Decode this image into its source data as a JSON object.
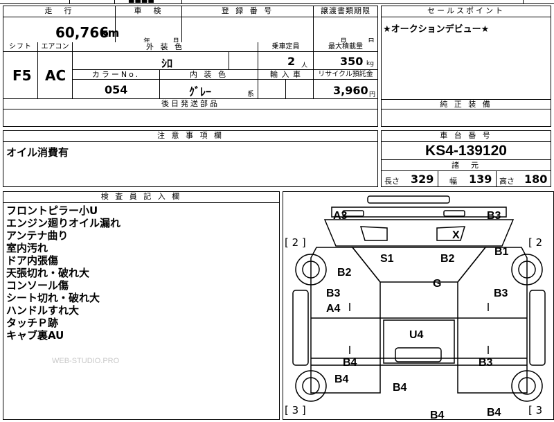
{
  "top_fragment": {
    "text": "■■■■"
  },
  "mileage": {
    "header": "走　行",
    "value": "60,766",
    "unit": "km"
  },
  "inspection": {
    "header": "車　検",
    "year_label": "年",
    "month_label": "月"
  },
  "registration": {
    "header": "登 録 番 号"
  },
  "transfer": {
    "header": "譲渡書類期限",
    "month_label": "月",
    "day_label": "日"
  },
  "sales_point": {
    "header": "セールスポイント",
    "text": "★オークションデビュー★"
  },
  "shift": {
    "header": "シフト",
    "value": "F5"
  },
  "aircon": {
    "header": "エアコン",
    "value": "AC"
  },
  "exterior": {
    "header": "外 装 色",
    "value": "ｼﾛ"
  },
  "capacity": {
    "header": "乗車定員",
    "value": "2",
    "unit": "人"
  },
  "max_load": {
    "header": "最大積載量",
    "value": "350",
    "unit": "kg"
  },
  "color_no": {
    "header": "カラーNo.",
    "value": "054"
  },
  "interior": {
    "header": "内 装 色",
    "value": "ｸﾞﾚｰ",
    "suffix": "系"
  },
  "import": {
    "header": "輸 入 車"
  },
  "recycle": {
    "header": "リサイクル預託金",
    "value": "3,960",
    "unit": "円"
  },
  "later_parts": {
    "header": "後日発送部品"
  },
  "genuine_equip": {
    "header": "純 正 装 備"
  },
  "notes": {
    "header": "注 意 事 項 欄",
    "text": "オイル消費有"
  },
  "chassis": {
    "header": "車 台 番 号",
    "value": "KS4-139120"
  },
  "specs": {
    "header": "諸　元",
    "length_label": "長さ",
    "length": "329",
    "width_label": "幅",
    "width": "139",
    "height_label": "高さ",
    "height": "180"
  },
  "inspector": {
    "header": "検 査 員 記 入 欄",
    "lines": [
      "フロントピラー小U",
      "エンジン廻りオイル漏れ",
      "アンテナ曲り",
      "室内汚れ",
      "ドア内張傷",
      "天張切れ・破れ大",
      "コンソール傷",
      "シート切れ・破れ大",
      "ハンドルすれ大",
      "タッチＰ跡",
      "キャブ裏AU"
    ]
  },
  "watermark": "WEB-STUDIO.PRO",
  "diagram": {
    "bracket_2_left": "[ 2 ]",
    "bracket_2_right": "[ 2",
    "bracket_3_left": "[ 3 ]",
    "bracket_3_right": "[ 3",
    "labels": {
      "A3": "A3",
      "B3_top": "B3",
      "X": "X",
      "B1": "B1",
      "S1": "S1",
      "B2_center": "B2",
      "B2_left": "B2",
      "G": "G",
      "B3_left": "B3",
      "B3_right": "B3",
      "A4": "A4",
      "U4": "U4",
      "B4_left": "B4",
      "B3_rear": "B3",
      "B4_low": "B4",
      "B4_center": "B4",
      "B4_bottom": "B4",
      "B4_right": "B4"
    }
  }
}
